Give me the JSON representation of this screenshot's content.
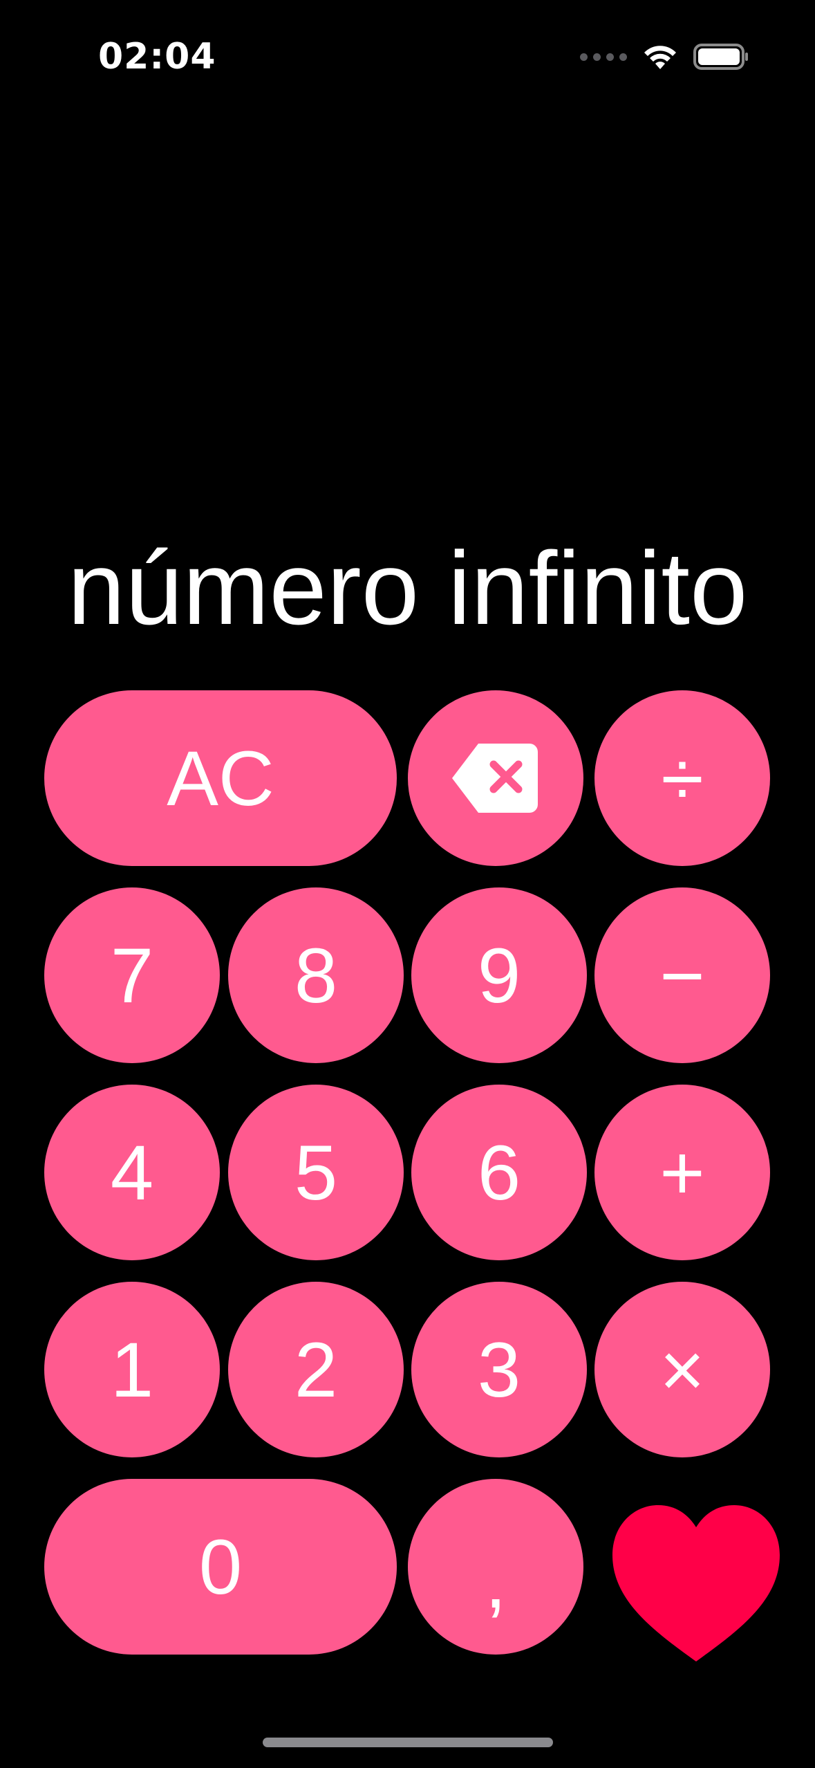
{
  "status_bar": {
    "time": "02:04",
    "icons": [
      "signal-dots-icon",
      "wifi-icon",
      "battery-icon"
    ]
  },
  "display": {
    "value": "número infinito"
  },
  "keys": {
    "clear": "AC",
    "backspace_icon": "backspace-icon",
    "divide": "÷",
    "seven": "7",
    "eight": "8",
    "nine": "9",
    "minus": "−",
    "four": "4",
    "five": "5",
    "six": "6",
    "plus": "+",
    "one": "1",
    "two": "2",
    "three": "3",
    "multiply": "×",
    "zero": "0",
    "decimal": ",",
    "heart_icon": "heart-icon"
  },
  "colors": {
    "background": "#000000",
    "key": "#ff5a8f",
    "heart": "#ff0048",
    "text": "#ffffff"
  }
}
